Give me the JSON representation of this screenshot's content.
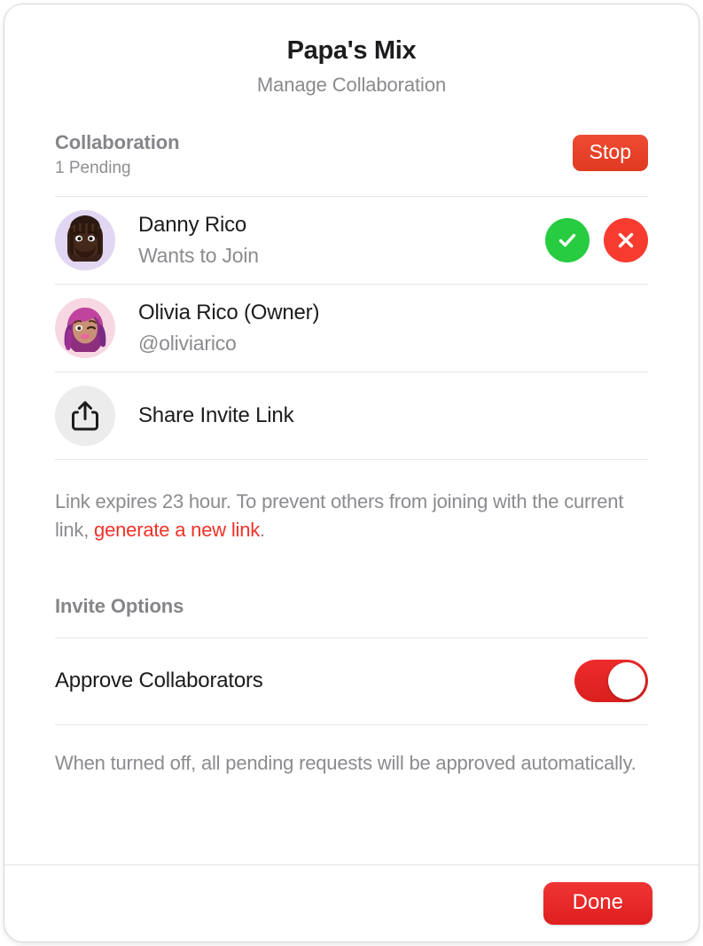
{
  "dialog": {
    "title": "Papa's Mix",
    "subtitle": "Manage Collaboration"
  },
  "collaboration": {
    "section_title": "Collaboration",
    "pending_count_label": "1 Pending",
    "stop_label": "Stop",
    "members": [
      {
        "name": "Danny Rico",
        "status": "Wants to Join",
        "avatar": "memoji-danny",
        "avatar_bg": "#e1d7f2",
        "accept_icon": "check-icon",
        "decline_icon": "close-icon",
        "has_actions": true
      },
      {
        "name": "Olivia Rico (Owner)",
        "status": "@oliviarico",
        "avatar": "memoji-olivia",
        "avatar_bg": "#f7d8e2",
        "has_actions": false
      }
    ],
    "share": {
      "icon": "share-icon",
      "label": "Share Invite Link"
    },
    "footnote": {
      "before_link": "Link expires 23 hour. To prevent others from joining with the current link, ",
      "link_text": "generate a new link",
      "after_link": ".",
      "link_color": "#f03228"
    }
  },
  "invite_options": {
    "section_title": "Invite Options",
    "approve": {
      "label": "Approve Collaborators",
      "toggle_state": "on",
      "toggle_color": "#e02323"
    },
    "note": "When turned off, all pending requests will be approved automatically."
  },
  "footer": {
    "done_label": "Done"
  }
}
